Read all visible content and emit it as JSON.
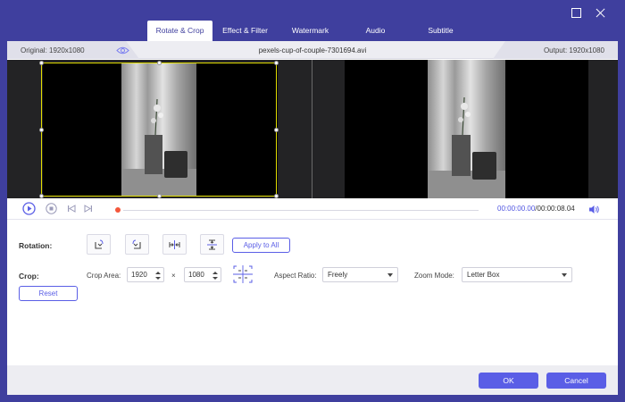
{
  "tabs": [
    {
      "label": "Rotate & Crop",
      "active": true
    },
    {
      "label": "Effect & Filter",
      "active": false
    },
    {
      "label": "Watermark",
      "active": false
    },
    {
      "label": "Audio",
      "active": false
    },
    {
      "label": "Subtitle",
      "active": false
    }
  ],
  "window": {
    "maximize_icon": "maximize-icon",
    "close_icon": "close-icon"
  },
  "preview": {
    "original": "Original: 1920x1080",
    "filename": "pexels-cup-of-couple-7301694.avi",
    "output": "Output: 1920x1080"
  },
  "player": {
    "current_time": "00:00:00.00",
    "total_time": "/00:00:08.04",
    "progress": 0
  },
  "rotation": {
    "label": "Rotation:",
    "buttons": [
      "rotate-left-icon",
      "rotate-right-icon",
      "flip-horizontal-icon",
      "flip-vertical-icon"
    ],
    "apply_all": "Apply to All"
  },
  "crop": {
    "label": "Crop:",
    "area_label": "Crop Area:",
    "width": "1920",
    "times": "×",
    "height": "1080",
    "aspect_label": "Aspect Ratio:",
    "aspect_value": "Freely",
    "zoom_label": "Zoom Mode:",
    "zoom_value": "Letter Box",
    "reset": "Reset"
  },
  "footer": {
    "ok": "OK",
    "cancel": "Cancel"
  },
  "colors": {
    "brand": "#3f3f9e",
    "accent": "#5a5ee6",
    "crop_border": "#e3df00",
    "progress_dot": "#f4573b"
  }
}
